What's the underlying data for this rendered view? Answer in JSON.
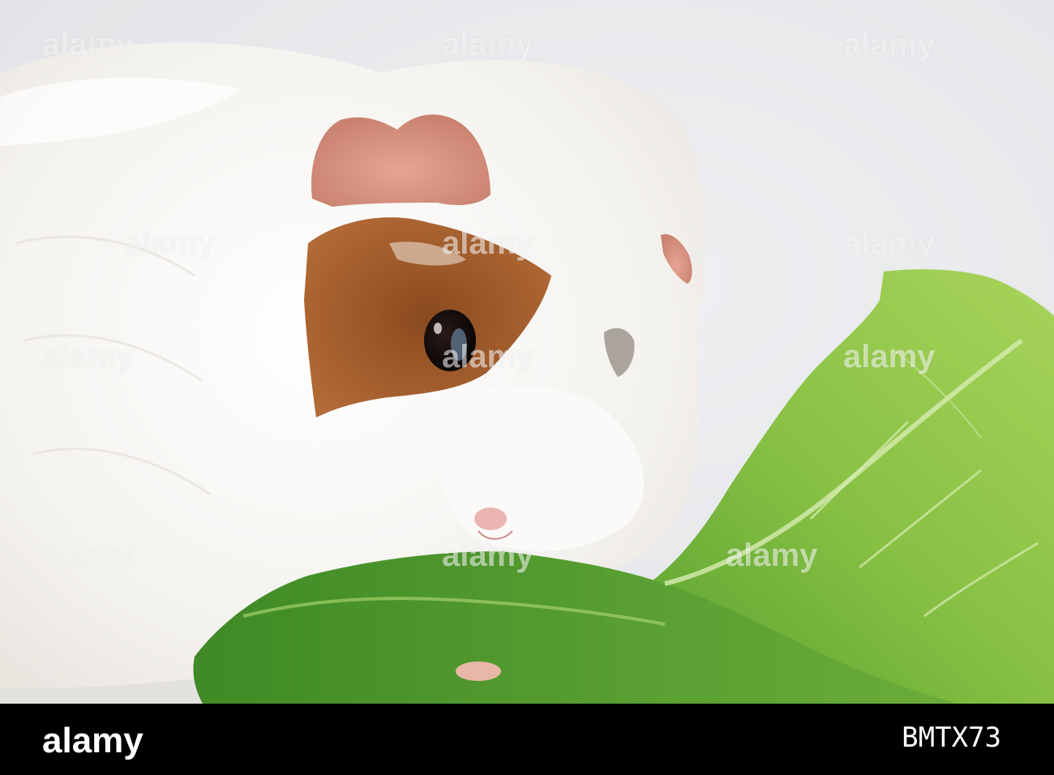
{
  "photo": {
    "subject": "guinea-pig",
    "object": "lettuce-leaf",
    "background_color": "#e9eaec",
    "fur_color": "#f7f5f2",
    "patch_color": "#a25a2a",
    "lettuce_color": "#7fb53a"
  },
  "watermark": {
    "text": "alamy"
  },
  "footer": {
    "logo": "alamy",
    "ref_label": "",
    "image_id": "BMTX73"
  }
}
